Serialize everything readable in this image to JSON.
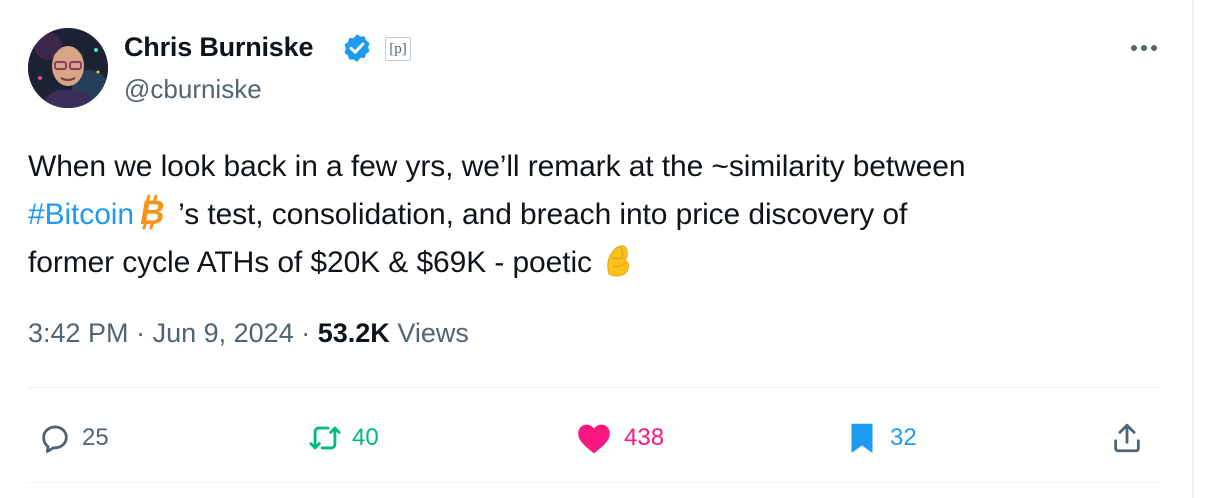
{
  "author": {
    "name": "Chris Burniske",
    "handle": "@cburniske",
    "affiliation_label": "p"
  },
  "tweet": {
    "line1": "When we look back in a few yrs, we’ll remark at the ~similarity between",
    "hashtag": "#Bitcoin",
    "line2_rest": " ’s test, consolidation, and breach into price discovery of",
    "line3": "former cycle ATHs of $20K & $69K - poetic",
    "time": "3:42 PM",
    "date": "Jun 9, 2024",
    "sep": "·",
    "views_count": "53.2K",
    "views_label": "Views"
  },
  "actions": {
    "replies": "25",
    "reposts": "40",
    "likes": "438",
    "bookmarks": "32"
  },
  "colors": {
    "text": "#0f1419",
    "secondary": "#536471",
    "link": "#1d9bf0",
    "repost": "#00ba7c",
    "like": "#f91880",
    "bookmark": "#1d9bf0",
    "bitcoin": "#f7931a",
    "verified": "#1d9bf0"
  },
  "icons": {
    "verified": "verified-badge-icon",
    "more": "more-dots-icon",
    "bitcoin": "bitcoin-icon",
    "pinched": "pinched-fingers-icon",
    "reply": "reply-icon",
    "repost": "repost-icon",
    "like": "heart-icon",
    "bookmark": "bookmark-icon",
    "share": "share-icon"
  }
}
